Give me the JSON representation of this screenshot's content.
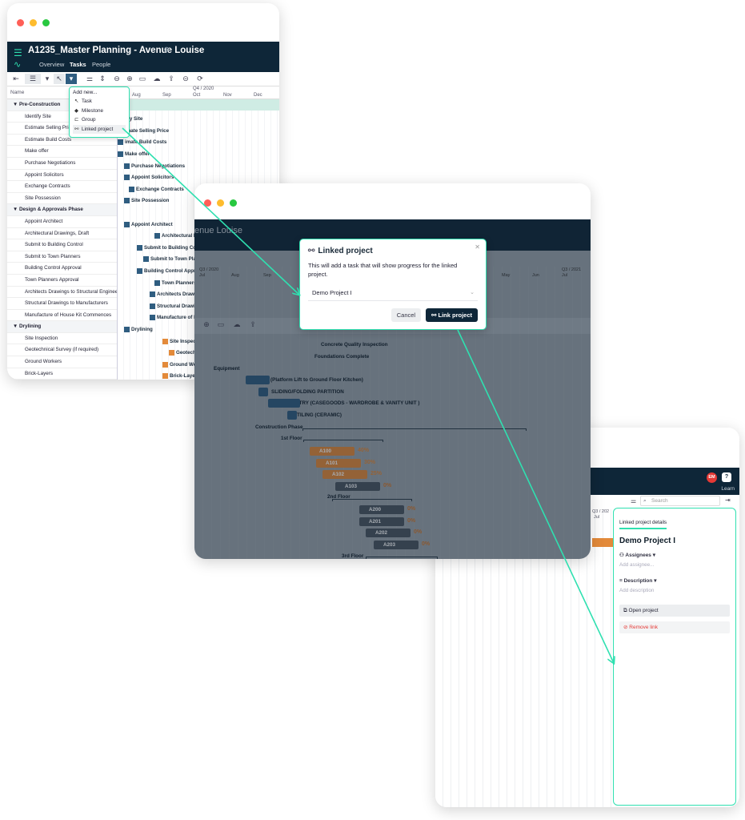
{
  "win1": {
    "project_title": "A1235_Master Planning - Avenue Louise",
    "tabs": [
      "Overview",
      "Tasks",
      "People"
    ],
    "name_header": "Name",
    "quarter": "Q4 / 2020",
    "months": [
      "Aug",
      "Sep",
      "Oct",
      "Nov",
      "Dec"
    ],
    "rows": [
      {
        "label": "▼ Pre-Construction",
        "group": true
      },
      {
        "label": "Identify Site"
      },
      {
        "label": "Estimate Selling Price"
      },
      {
        "label": "Estimate Build Costs"
      },
      {
        "label": "Make offer"
      },
      {
        "label": "Purchase Negotiations"
      },
      {
        "label": "Appoint Solicitors"
      },
      {
        "label": "Exchange Contracts"
      },
      {
        "label": "Site Possession"
      },
      {
        "label": "▼ Design & Approvals Phase",
        "group": true
      },
      {
        "label": "Appoint Architect"
      },
      {
        "label": "Architectural Drawings, Draft"
      },
      {
        "label": "Submit to Building Control"
      },
      {
        "label": "Submit to Town Planners"
      },
      {
        "label": "Building Control Approval"
      },
      {
        "label": "Town Planners Approval"
      },
      {
        "label": "Architects Drawings to Structural Engineer"
      },
      {
        "label": "Structural Drawings to Manufacturers"
      },
      {
        "label": "Manufacture of House Kit Commences"
      },
      {
        "label": "▼ Drylining",
        "group": true
      },
      {
        "label": "Site Inspection"
      },
      {
        "label": "Geotechnical Survey (if required)"
      },
      {
        "label": "Ground Workers"
      },
      {
        "label": "Brick-Layers"
      }
    ],
    "gantt_labels": [
      "tify Site",
      "imate Selling Price",
      "imate Build Costs",
      "Make offer",
      "Purchase Negotiations",
      "Appoint Solicitors",
      "Exchange Contracts",
      "Site Possession",
      "Appoint Architect",
      "Architectural Dra",
      "Submit to Building Co",
      "Submit to Town Plann",
      "Building Control Approva",
      "Town Planners App",
      "Architects Draw",
      "Structural Drawi",
      "Manufacture of Ho",
      "Drylining",
      "Site Inspecti",
      "Geotechn",
      "Ground Wo",
      "Brick-Laye"
    ],
    "dropdown": {
      "title": "Add new...",
      "items": [
        "Task",
        "Milestone",
        "Group",
        "Linked project"
      ]
    }
  },
  "win2": {
    "project_title_partial": "enue Louise",
    "quarter_left": "Q3 / 2020",
    "quarter_right": "Q3 / 2021",
    "months": [
      "Jul",
      "Aug",
      "Sep",
      "May",
      "Jun",
      "Jul"
    ],
    "tasks": [
      "Concrete Quality Inspection",
      "Foundations Complete",
      "Equipment",
      "LIFT (Platform Lift to Ground Floor Kitchen)",
      "SLIDING/FOLDING PARTITION",
      "CARPENTRY (CASEGOODS - WARDROBE & VANITY UNIT )",
      "TILING (CERAMIC)",
      "Construction Phase",
      "1st Floor",
      "2nd Floor",
      "3rd Floor"
    ],
    "units": [
      {
        "name": "A100",
        "pct": "40%"
      },
      {
        "name": "A101",
        "pct": "30%"
      },
      {
        "name": "A102",
        "pct": "25%"
      },
      {
        "name": "A103",
        "pct": "0%"
      },
      {
        "name": "A200",
        "pct": "0%"
      },
      {
        "name": "A201",
        "pct": "0%"
      },
      {
        "name": "A202",
        "pct": "0%"
      },
      {
        "name": "A203",
        "pct": "0%"
      }
    ],
    "modal": {
      "title": "Linked project",
      "description": "This will add a task that will show progress for the linked project.",
      "selected_project": "Demo Project I",
      "cancel": "Cancel",
      "confirm": "Link project"
    }
  },
  "win3": {
    "avatar_initials": "EM",
    "help": "?",
    "learn": "Learn",
    "search_placeholder": "Search",
    "quarter": "Q3 / 202",
    "month": "Jul",
    "panel": {
      "tab": "Linked project details",
      "project_name": "Demo Project I",
      "assignees_label": "Assignees",
      "assignees_placeholder": "Add assignee...",
      "description_label": "Description",
      "description_placeholder": "Add description",
      "open_project": "Open project",
      "remove_link": "Remove link"
    }
  },
  "colors": {
    "accent": "#2fe0b0",
    "navy": "#0e2638",
    "task_blue": "#2f5d80",
    "task_orange": "#e38a3a",
    "danger": "#e53935"
  }
}
